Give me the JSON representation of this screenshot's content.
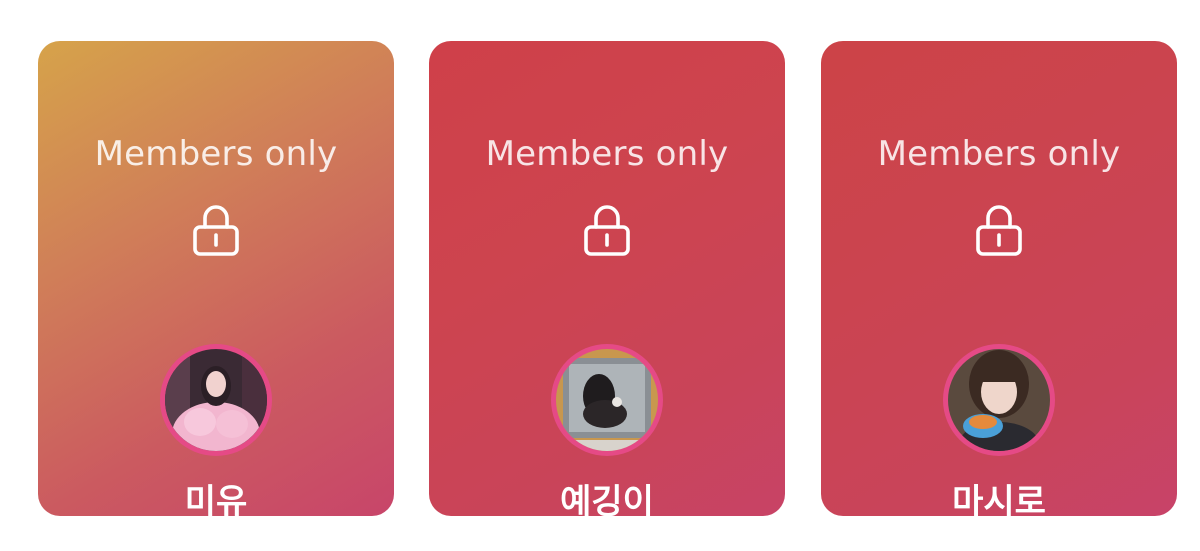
{
  "cards": [
    {
      "label": "Members only",
      "icon": "lock-icon",
      "name": "미유",
      "avatar": "avatar-photo-pink-dress"
    },
    {
      "label": "Members only",
      "icon": "lock-icon",
      "name": "예깅이",
      "avatar": "avatar-photo-mirror-selfie"
    },
    {
      "label": "Members only",
      "icon": "lock-icon",
      "name": "마시로",
      "avatar": "avatar-photo-eating"
    }
  ],
  "colors": {
    "card_1_top": "#d6a34a",
    "card_1_bottom": "#c8456a",
    "card_2": "#cd444f",
    "card_3": "#cb4450",
    "avatar_ring": "#e54a86",
    "text": "#ffffff"
  }
}
